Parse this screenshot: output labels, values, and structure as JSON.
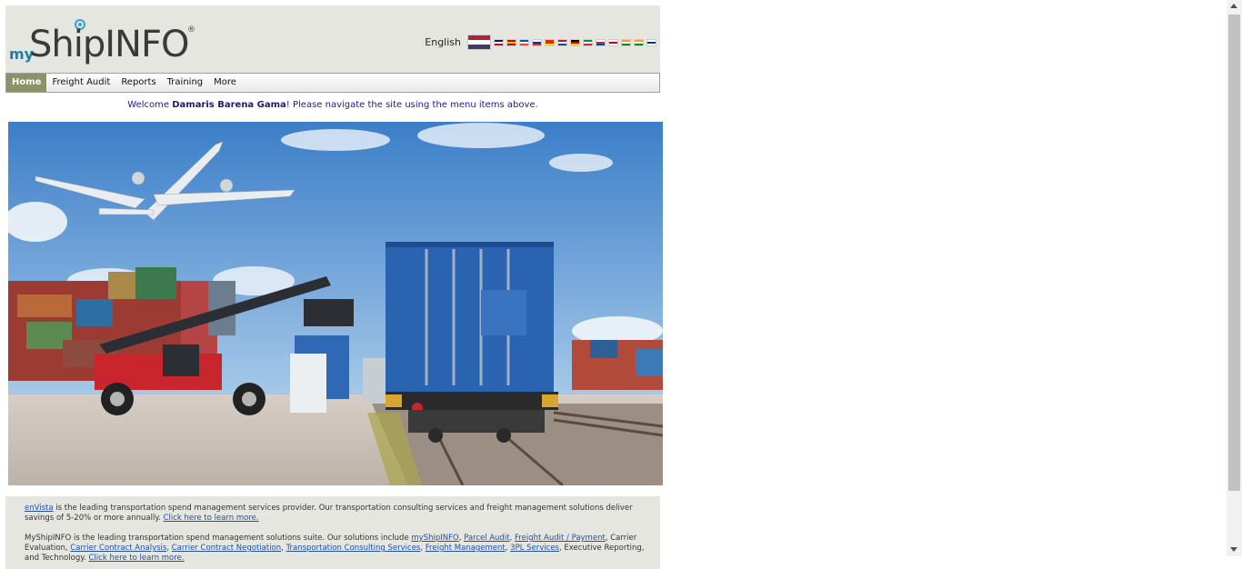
{
  "header": {
    "logo_my": "my",
    "logo_ship": "ShipINFO",
    "logo_reg": "®",
    "language_label": "English",
    "flags": [
      {
        "name": "us-flag-icon",
        "colors": [
          "#b22234",
          "#ffffff",
          "#3c3b6e"
        ]
      },
      {
        "name": "uk-flag-icon",
        "colors": [
          "#012169",
          "#ffffff",
          "#c8102e"
        ]
      },
      {
        "name": "es-flag-icon",
        "colors": [
          "#aa151b",
          "#f1bf00",
          "#aa151b"
        ]
      },
      {
        "name": "fr-flag-icon",
        "colors": [
          "#0055a4",
          "#ffffff",
          "#ef4135"
        ]
      },
      {
        "name": "ru-flag-icon",
        "colors": [
          "#ffffff",
          "#0039a6",
          "#d52b1e"
        ]
      },
      {
        "name": "cn-flag-icon",
        "colors": [
          "#de2910",
          "#de2910",
          "#ffde00"
        ]
      },
      {
        "name": "nl-flag-icon",
        "colors": [
          "#ae1c28",
          "#ffffff",
          "#21468b"
        ]
      },
      {
        "name": "de-flag-icon",
        "colors": [
          "#000000",
          "#dd0000",
          "#ffce00"
        ]
      },
      {
        "name": "it-flag-icon",
        "colors": [
          "#009246",
          "#ffffff",
          "#ce2b37"
        ]
      },
      {
        "name": "kr-flag-icon",
        "colors": [
          "#ffffff",
          "#cd2e3a",
          "#0047a0"
        ]
      },
      {
        "name": "jp-flag-icon",
        "colors": [
          "#ffffff",
          "#bc002d",
          "#ffffff"
        ]
      },
      {
        "name": "in-flag-icon",
        "colors": [
          "#ff9933",
          "#ffffff",
          "#138808"
        ]
      },
      {
        "name": "in2-flag-icon",
        "colors": [
          "#ff9933",
          "#ffffff",
          "#138808"
        ]
      },
      {
        "name": "fi-flag-icon",
        "colors": [
          "#ffffff",
          "#003580",
          "#ffffff"
        ]
      }
    ]
  },
  "menu": {
    "items": [
      {
        "label": "Home",
        "active": true
      },
      {
        "label": "Freight Audit",
        "active": false
      },
      {
        "label": "Reports",
        "active": false
      },
      {
        "label": "Training",
        "active": false
      },
      {
        "label": "More",
        "active": false
      }
    ]
  },
  "welcome": {
    "prefix": "Welcome ",
    "name": "Damaris Barena Gama",
    "suffix": "! Please navigate the site using the menu items above."
  },
  "hero": {
    "sky_color": "#4c8fd0",
    "container_color": "#2a63b0",
    "ground_color": "#cbc3bc"
  },
  "footer": {
    "p1_link": "enVista",
    "p1_text": " is the leading transportation spend management services provider. Our transportation consulting services and freight management solutions deliver savings of 5-20% or more annually. ",
    "p1_more": "Click here to learn more.",
    "p2_text1": "MyShipINFO is the leading transportation spend management solutions suite. Our solutions include ",
    "p2_l1": "myShipINFO",
    "p2_l2": "Parcel Audit",
    "p2_l3": "Freight Audit / Payment",
    "p2_text2": ", Carrier Evaluation, ",
    "p2_l4": "Carrier Contract Analysis",
    "p2_l5": "Carrier Contract Negotiation",
    "p2_l6": "Transportation Consulting Services",
    "p2_l7": "Freight Management",
    "p2_l8": "3PL Services",
    "p2_text3": ", Executive Reporting, and Technology. ",
    "p2_more": "Click here to learn more."
  }
}
